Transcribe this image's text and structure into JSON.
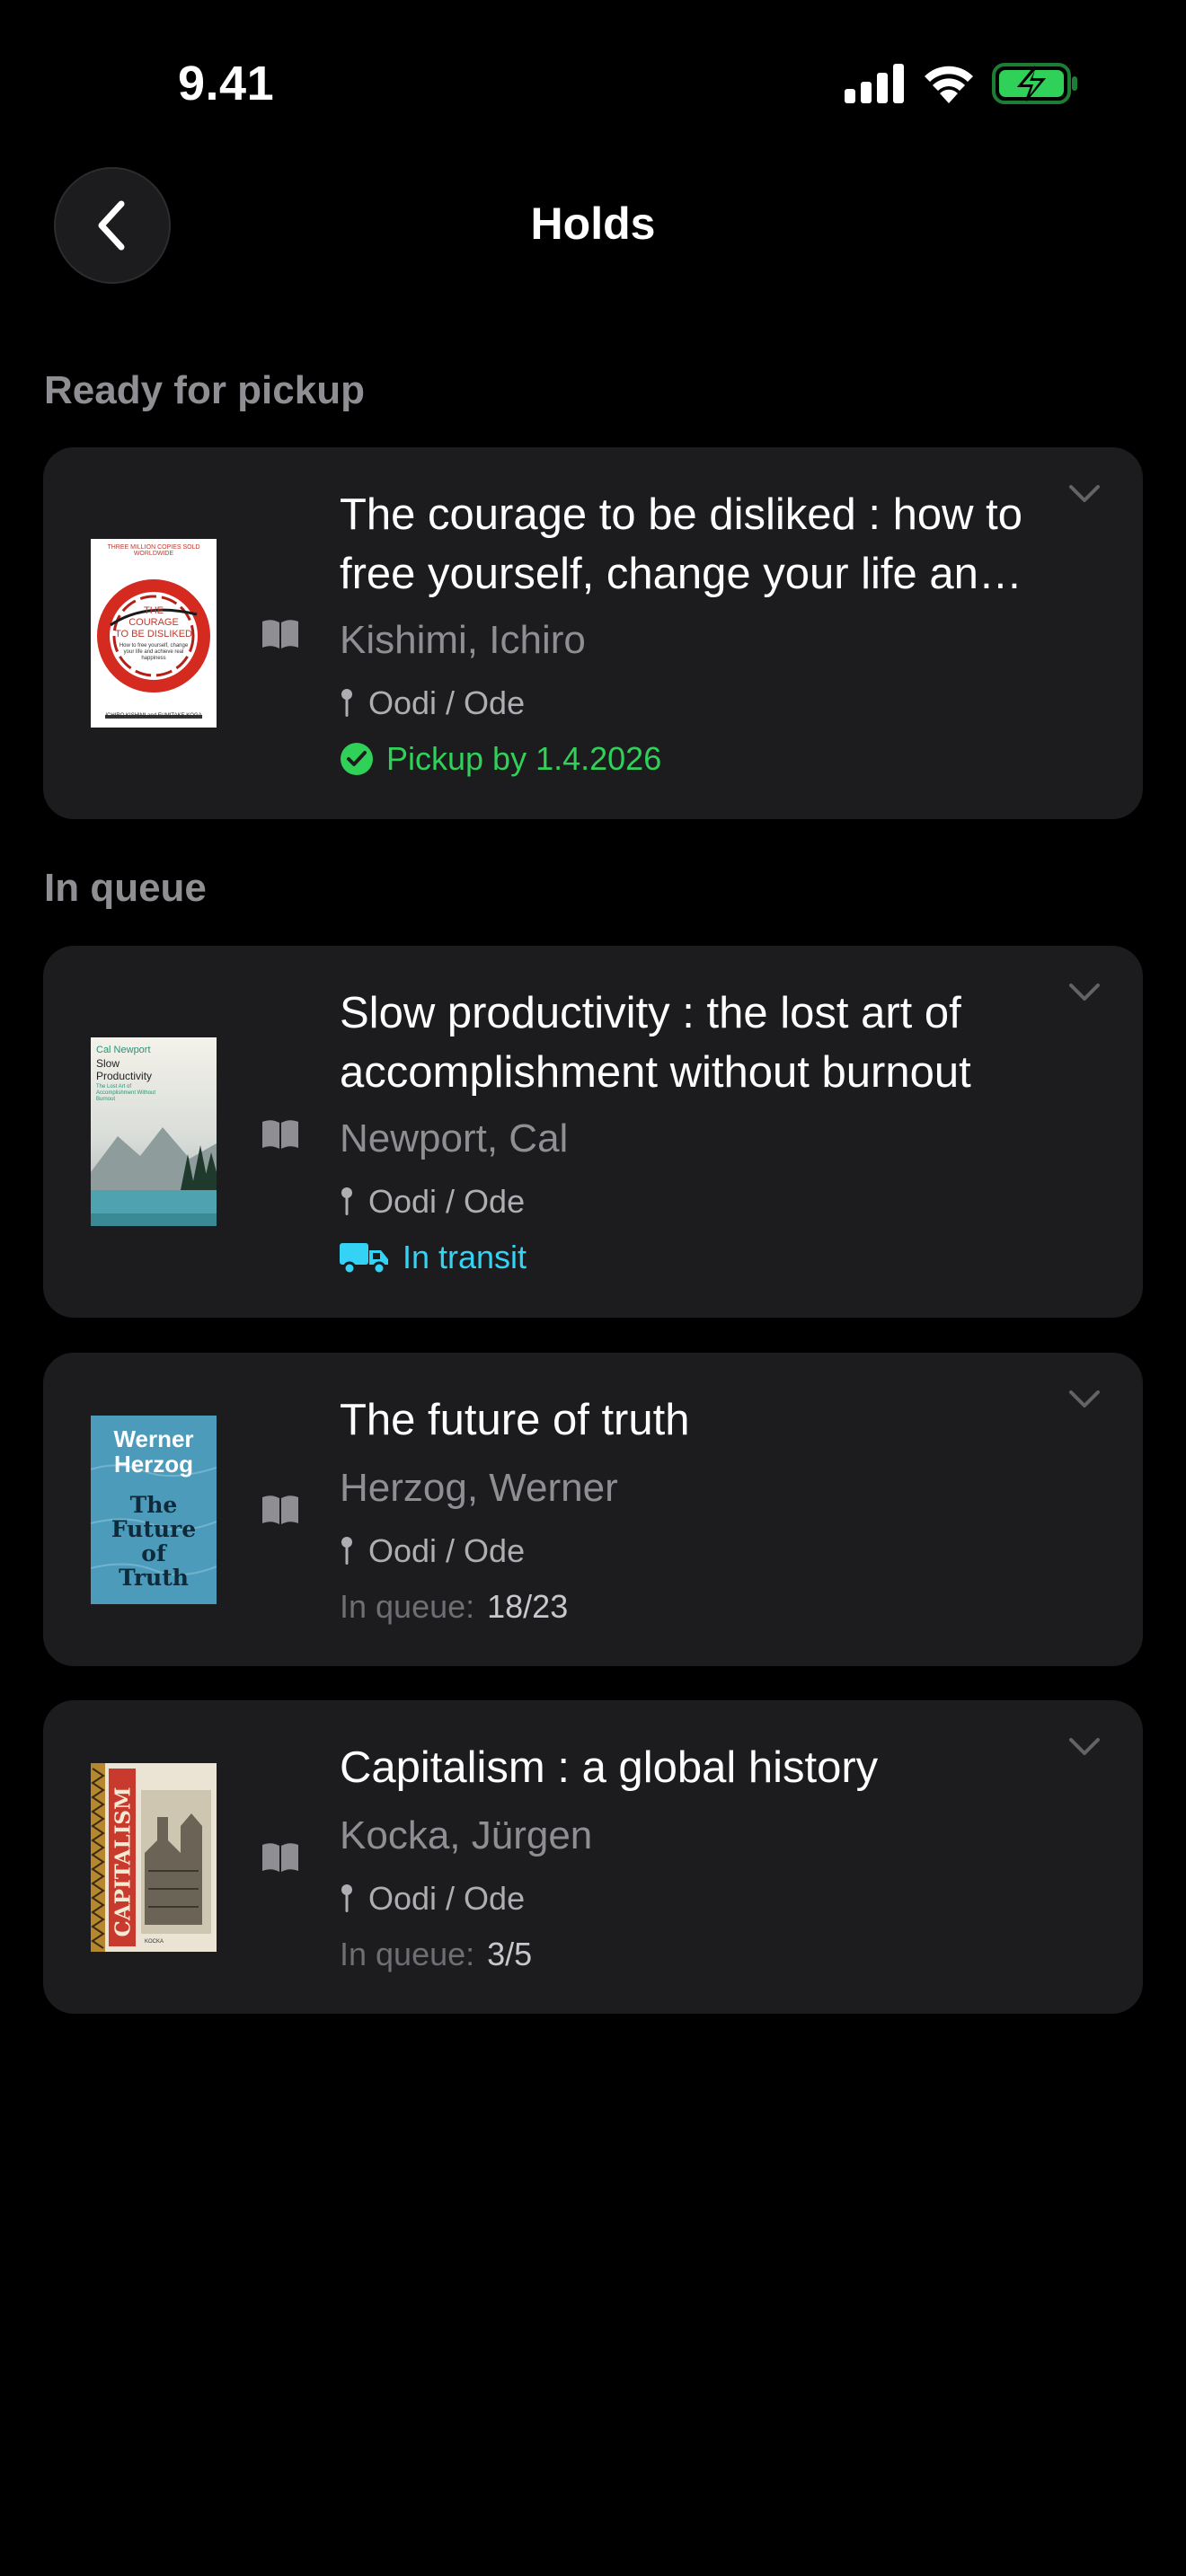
{
  "status_bar": {
    "time": "9.41",
    "icons": [
      "cellular-signal-icon",
      "wifi-icon",
      "battery-charging-icon"
    ],
    "battery_color": "#30d158"
  },
  "nav": {
    "back_icon": "chevron-left-icon",
    "title": "Holds"
  },
  "sections": {
    "ready_title": "Ready for pickup",
    "queue_title": "In queue"
  },
  "colors": {
    "ready_green": "#30d158",
    "transit_cyan": "#34d3f5",
    "card_bg": "#1c1c1e",
    "secondary_text": "#8e8e93"
  },
  "holds": [
    {
      "title": "The courage to be disliked : how to free yourself, change your life and achieve real happiness",
      "author": "Kishimi, Ichiro",
      "location": "Oodi / Ode",
      "status": "Pickup by 1.4.2026",
      "status_icon": "check-circle-icon",
      "format_icon": "book-icon",
      "cover": {
        "top": "THREE MILLION COPIES SOLD WORLDWIDE",
        "line1": "THE",
        "line2": "COURAGE",
        "line3": "TO BE DISLIKED",
        "sub": "How to free yourself, change your life and achieve real happiness",
        "authors": "ICHIRO KISHIMI and FUMITAKE KOGA"
      }
    },
    {
      "title": "Slow productivity : the lost art of accomplishment without burnout",
      "author": "Newport, Cal",
      "location": "Oodi / Ode",
      "status": "In transit",
      "status_icon": "truck-icon",
      "format_icon": "book-icon",
      "cover": {
        "author": "Cal Newport",
        "title1": "Slow",
        "title2": "Productivity",
        "sub": "The Lost Art of Accomplishment Without Burnout"
      }
    },
    {
      "title": "The future of truth",
      "author": "Herzog, Werner",
      "location": "Oodi / Ode",
      "queue_label": "In queue:",
      "queue_value": "18/23",
      "format_icon": "book-icon",
      "cover": {
        "author1": "Werner",
        "author2": "Herzog",
        "title1": "The",
        "title2": "Future",
        "title3": "of",
        "title4": "Truth"
      }
    },
    {
      "title": "Capitalism : a global history",
      "author": "Kocka, Jürgen",
      "location": "Oodi / Ode",
      "queue_label": "In queue:",
      "queue_value": "3/5",
      "format_icon": "book-icon",
      "cover": {
        "title": "CAPITALISM",
        "author": "KOCKA"
      }
    }
  ]
}
